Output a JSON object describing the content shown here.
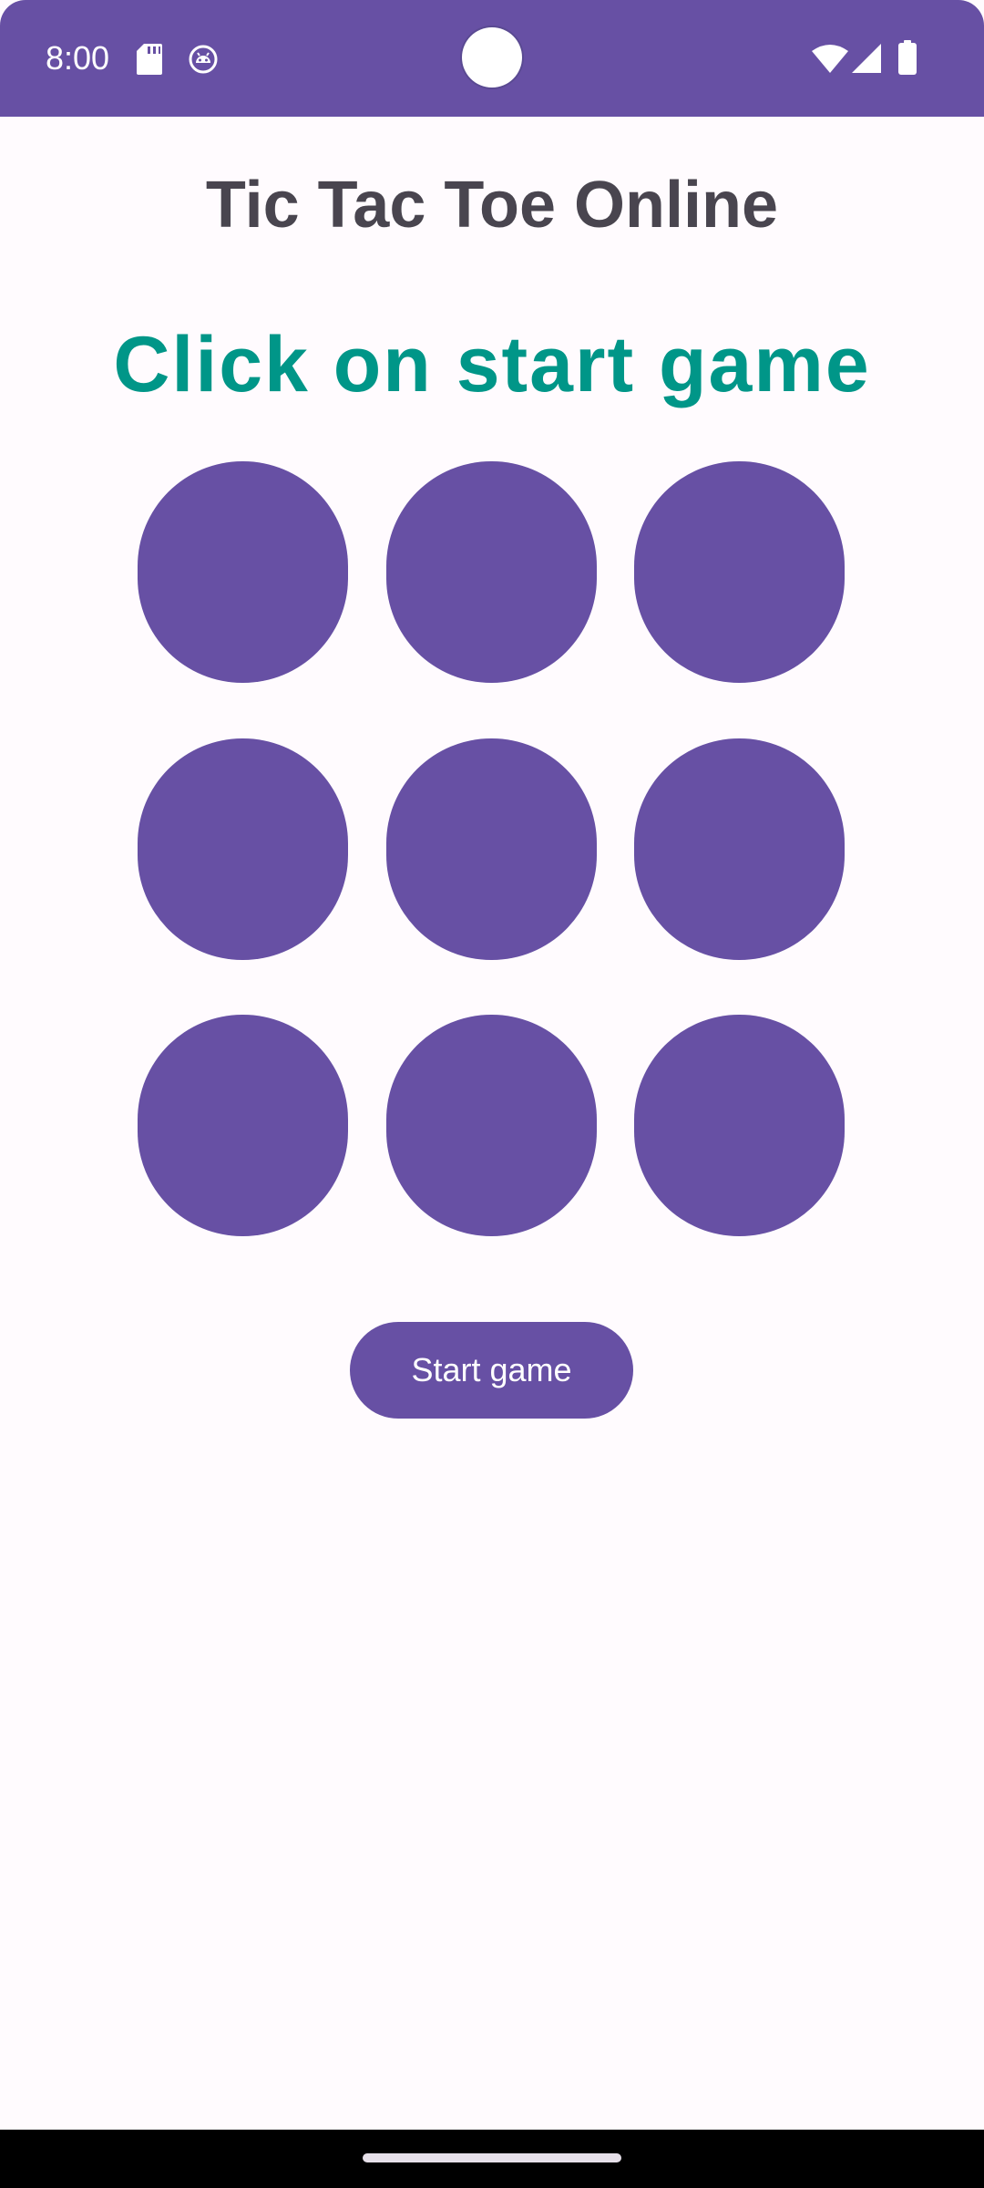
{
  "status_bar": {
    "time": "8:00",
    "left_icons": [
      "sd-card-icon",
      "android-debug-icon"
    ],
    "right_icons": [
      "wifi-icon",
      "cellular-signal-icon",
      "battery-icon"
    ]
  },
  "app": {
    "title": "Tic Tac Toe Online",
    "status_message": "Click on start game"
  },
  "board": {
    "cells": [
      "",
      "",
      "",
      "",
      "",
      "",
      "",
      "",
      ""
    ]
  },
  "actions": {
    "start_label": "Start game"
  },
  "colors": {
    "primary": "#6750a4",
    "status_text": "#009688",
    "title_text": "#49454f",
    "background": "#fffbfe"
  }
}
